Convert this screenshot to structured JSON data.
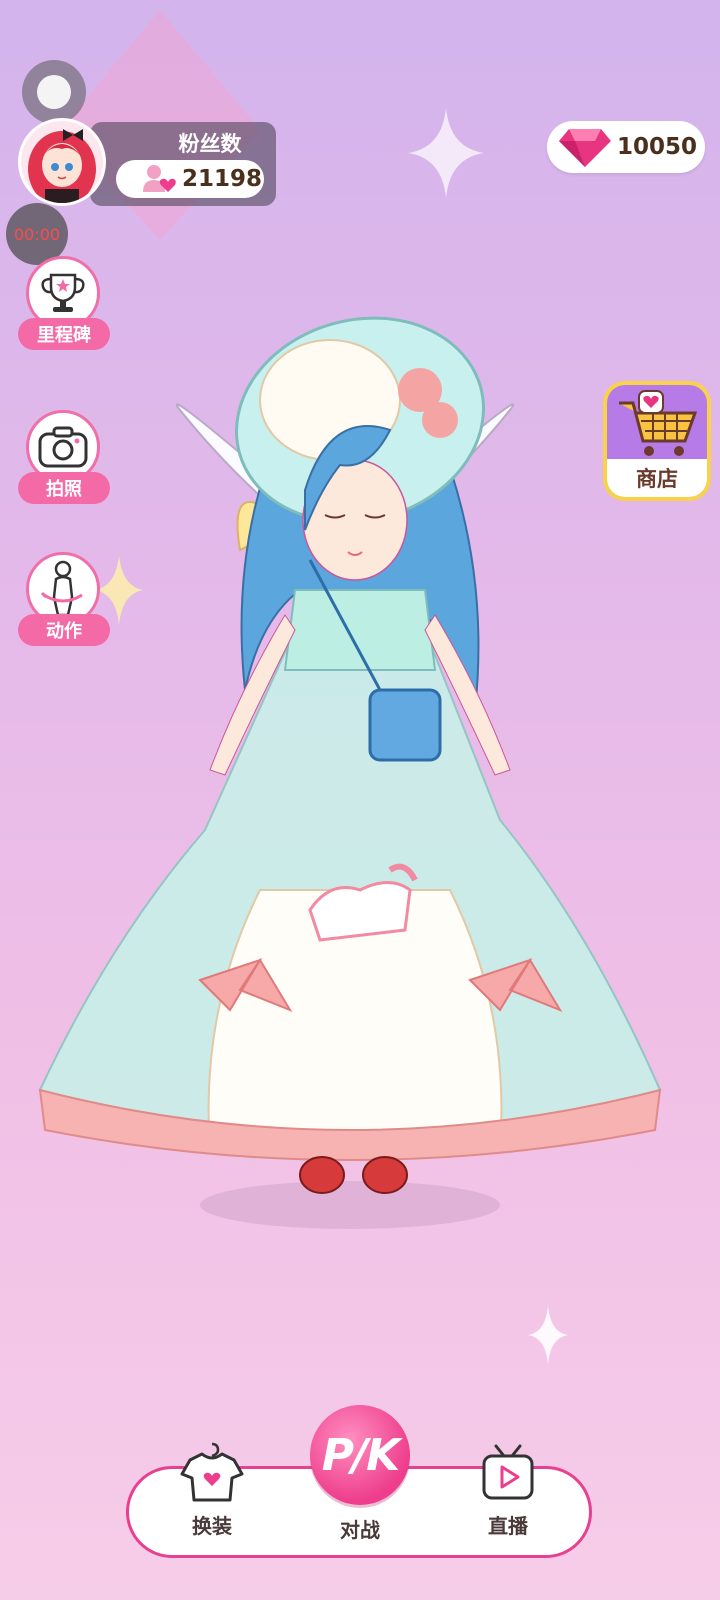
{
  "status": {
    "timer": "00:00"
  },
  "fans": {
    "label": "粉丝数",
    "count": "21198"
  },
  "currency": {
    "gems": "10050",
    "icon": "gem-icon",
    "color": "#e8357f"
  },
  "side_menu": {
    "milestone_label": "里程碑",
    "photo_label": "拍照",
    "action_label": "动作"
  },
  "shop": {
    "label": "商店"
  },
  "bottom_nav": {
    "outfit_label": "换装",
    "pk_label": "对战",
    "pk_badge": "P/K",
    "live_label": "直播"
  },
  "colors": {
    "accent": "#f36aa7",
    "nav_border": "#e83f8f",
    "shop_frame": "#f7d24a"
  }
}
